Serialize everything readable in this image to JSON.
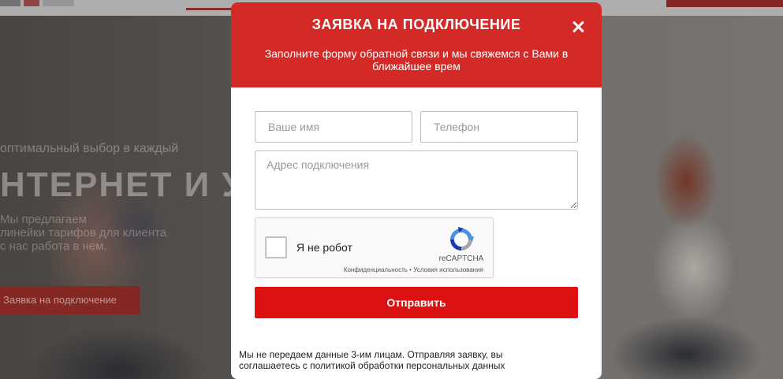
{
  "background": {
    "small_text": "оптимальный выбор в каждый",
    "heading": "НТЕРНЕТ И УМН",
    "desc_lines": [
      "Мы предлагаем",
      "линейки тарифов для клиента",
      "с нас работа в нем."
    ],
    "cta_label": "Заявка на подключение"
  },
  "modal": {
    "title": "ЗАЯВКА НА ПОДКЛЮЧЕНИЕ",
    "subtitle": "Заполните форму обратной связи и мы свяжемся с Вами в ближайшее врем",
    "close_icon": "close-icon",
    "fields": {
      "name_placeholder": "Ваше имя",
      "phone_placeholder": "Телефон",
      "address_placeholder": "Адрес подключения"
    },
    "captcha": {
      "label": "Я не робот",
      "brand": "reCAPTCHA",
      "links": "Конфиденциальность • Условия использования",
      "logo_icon": "recaptcha-icon"
    },
    "submit_label": "Отправить",
    "disclaimer": "Мы не передаем данные 3-им лицам. Отправляя заявку, вы соглашаетесь с политикой обработки персональных данных"
  },
  "colors": {
    "header_red": "#d42a27",
    "button_red": "#dc1212"
  }
}
